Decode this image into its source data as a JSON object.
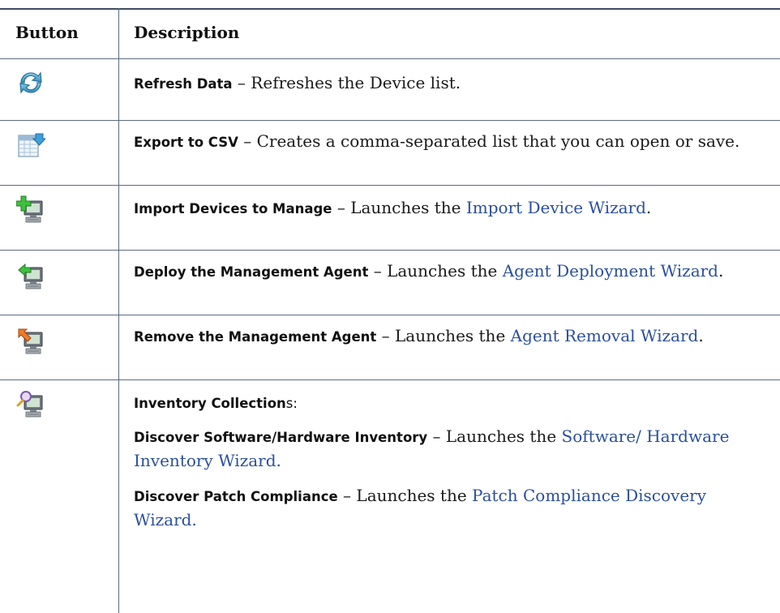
{
  "table": {
    "headers": {
      "button": "Button",
      "description": "Description"
    },
    "rows": [
      {
        "icon": "refresh-icon",
        "label": "Refresh Data",
        "dash": " – ",
        "text": "Refreshes the Device list."
      },
      {
        "icon": "export-csv-icon",
        "label": "Export to CSV",
        "dash": " – ",
        "text": "Creates a comma-separated list that you can open or save."
      },
      {
        "icon": "import-devices-icon",
        "label": "Import Devices to Manage",
        "dash": " – ",
        "text": "Launches the ",
        "link": "Import Device Wizard",
        "after": "."
      },
      {
        "icon": "deploy-agent-icon",
        "label": "Deploy the Management Agent",
        "dash": " – ",
        "text": "Launches the ",
        "link": "Agent Deployment Wizard",
        "after": "."
      },
      {
        "icon": "remove-agent-icon",
        "label": "Remove the Management Agent",
        "dash": " – ",
        "text": "Launches the ",
        "link": "Agent Removal Wizard",
        "after": "."
      },
      {
        "icon": "inventory-collection-icon",
        "heading_label": "Inventory Collection",
        "heading_suffix": "s:",
        "items": [
          {
            "label": "Discover Software/Hardware Inventory",
            "dash": " – ",
            "text": "Launches the ",
            "link": "Software/ Hardware Inventory Wizard."
          },
          {
            "label": "Discover Patch Compliance",
            "dash": " – ",
            "text": "Launches the ",
            "link": "Patch Compliance Discovery Wizard."
          }
        ]
      }
    ]
  },
  "colors": {
    "rule": "#5b6b82",
    "link": "#2a4f9f"
  }
}
